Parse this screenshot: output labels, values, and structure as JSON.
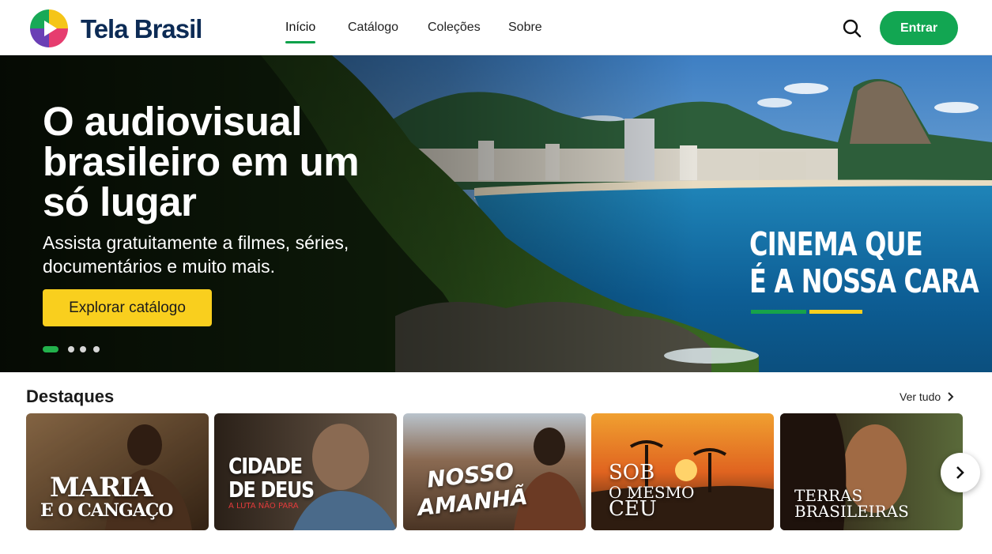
{
  "header": {
    "brand": "Tela Brasil",
    "nav": [
      {
        "label": "Início",
        "active": true
      },
      {
        "label": "Catálogo",
        "active": false
      },
      {
        "label": "Coleções",
        "active": false
      },
      {
        "label": "Sobre",
        "active": false
      }
    ],
    "search_icon": "search-icon",
    "login_label": "Entrar"
  },
  "hero": {
    "title": "O audiovisual brasileiro em um só lugar",
    "subtitle": "Assista gratuitamente a filmes, séries, documentários e muito mais.",
    "cta_label": "Explorar catálogo",
    "slogan_line1": "CINEMA QUE",
    "slogan_line2": "É A NOSSA CARA",
    "carousel_total": 4,
    "carousel_active": 1
  },
  "highlights": {
    "title": "Destaques",
    "see_all": "Ver tudo",
    "cards": [
      {
        "title_line1": "MARIA",
        "title_line2": "E O CANGAÇO"
      },
      {
        "title_line1": "CIDADE",
        "title_line2": "DE DEUS",
        "tagline": "A LUTA NÃO PARA"
      },
      {
        "title_line1": "NOSSO",
        "title_line2": "AMANHÃ"
      },
      {
        "title_line1": "SOB",
        "title_line2": "O MESMO",
        "title_line3": "CÉU"
      },
      {
        "title_line1": "TERRAS",
        "title_line2": "BRASILEIRAS"
      }
    ]
  },
  "colors": {
    "brand_navy": "#0c2b55",
    "accent_green": "#12a652",
    "accent_yellow": "#f9cf1e"
  }
}
